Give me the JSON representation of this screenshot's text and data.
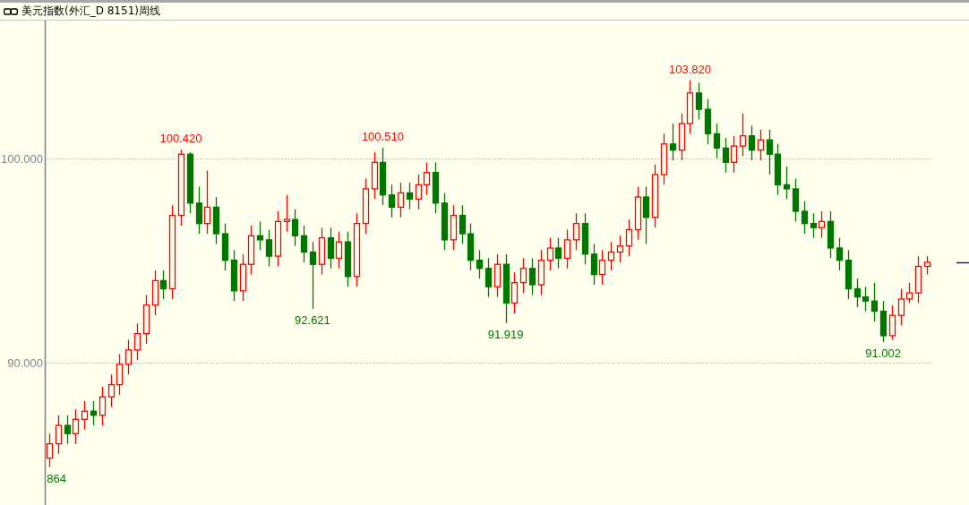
{
  "window": {
    "title": "美元指数(外汇_D 8151)周线"
  },
  "chart": {
    "chart_data": {
      "type": "candlestick",
      "ylim": [
        83,
        106.75
      ],
      "yticks": [
        {
          "value": 90,
          "label": "90.000"
        },
        {
          "value": 100,
          "label": "100.000"
        }
      ],
      "ohlc": [
        [
          85.3,
          86.5,
          84.86,
          86.0
        ],
        [
          86.0,
          87.4,
          85.5,
          86.9
        ],
        [
          86.9,
          87.4,
          86.0,
          86.5
        ],
        [
          86.5,
          87.7,
          86.0,
          87.2
        ],
        [
          87.2,
          88.1,
          86.7,
          87.6
        ],
        [
          87.6,
          88.1,
          86.9,
          87.4
        ],
        [
          87.4,
          88.8,
          86.9,
          88.3
        ],
        [
          88.3,
          89.4,
          87.8,
          88.9
        ],
        [
          88.9,
          90.4,
          88.4,
          89.9
        ],
        [
          89.9,
          91.1,
          89.4,
          90.6
        ],
        [
          90.6,
          91.9,
          90.1,
          91.4
        ],
        [
          91.4,
          93.3,
          90.9,
          92.8
        ],
        [
          92.8,
          94.5,
          92.3,
          94.0
        ],
        [
          94.0,
          94.5,
          93.1,
          93.6
        ],
        [
          93.6,
          97.7,
          93.1,
          97.2
        ],
        [
          97.2,
          100.42,
          96.7,
          100.2
        ],
        [
          100.2,
          100.3,
          97.3,
          97.8
        ],
        [
          97.8,
          98.6,
          96.3,
          96.8
        ],
        [
          96.8,
          99.4,
          96.3,
          97.6
        ],
        [
          97.6,
          98.1,
          95.8,
          96.3
        ],
        [
          96.3,
          96.8,
          94.5,
          95.0
        ],
        [
          95.0,
          95.5,
          93.0,
          93.5
        ],
        [
          93.5,
          95.3,
          93.0,
          94.8
        ],
        [
          94.8,
          96.7,
          94.3,
          96.2
        ],
        [
          96.2,
          96.9,
          95.5,
          96.0
        ],
        [
          96.0,
          96.5,
          94.7,
          95.2
        ],
        [
          95.2,
          97.4,
          94.7,
          96.9
        ],
        [
          96.9,
          98.2,
          96.4,
          97.0
        ],
        [
          97.0,
          97.5,
          95.7,
          96.2
        ],
        [
          96.2,
          96.7,
          94.9,
          95.4
        ],
        [
          95.4,
          95.9,
          92.62,
          94.8
        ],
        [
          94.8,
          96.6,
          94.3,
          96.1
        ],
        [
          96.1,
          96.6,
          94.6,
          95.1
        ],
        [
          95.1,
          96.4,
          94.6,
          95.9
        ],
        [
          95.9,
          96.4,
          93.7,
          94.2
        ],
        [
          94.2,
          97.3,
          93.7,
          96.8
        ],
        [
          96.8,
          99.0,
          96.3,
          98.5
        ],
        [
          98.5,
          100.3,
          98.0,
          99.8
        ],
        [
          99.8,
          100.51,
          97.7,
          98.2
        ],
        [
          98.2,
          98.7,
          97.1,
          97.6
        ],
        [
          97.6,
          98.8,
          97.1,
          98.3
        ],
        [
          98.3,
          98.8,
          97.5,
          98.0
        ],
        [
          98.0,
          99.2,
          97.5,
          98.7
        ],
        [
          98.7,
          99.8,
          98.2,
          99.3
        ],
        [
          99.3,
          99.8,
          97.3,
          97.8
        ],
        [
          97.8,
          98.3,
          95.5,
          96.0
        ],
        [
          96.0,
          97.7,
          95.5,
          97.2
        ],
        [
          97.2,
          97.7,
          95.8,
          96.3
        ],
        [
          96.3,
          96.8,
          94.5,
          95.0
        ],
        [
          95.0,
          95.5,
          94.1,
          94.6
        ],
        [
          94.6,
          95.1,
          93.2,
          93.7
        ],
        [
          93.7,
          95.3,
          93.2,
          94.8
        ],
        [
          94.8,
          95.3,
          91.92,
          92.9
        ],
        [
          92.9,
          94.4,
          92.4,
          93.9
        ],
        [
          93.9,
          95.1,
          93.4,
          94.6
        ],
        [
          94.6,
          95.1,
          93.3,
          93.8
        ],
        [
          93.8,
          95.5,
          93.3,
          95.0
        ],
        [
          95.0,
          96.1,
          94.5,
          95.6
        ],
        [
          95.6,
          96.1,
          94.6,
          95.1
        ],
        [
          95.1,
          96.5,
          94.6,
          96.0
        ],
        [
          96.0,
          97.3,
          95.5,
          96.8
        ],
        [
          96.8,
          97.3,
          94.8,
          95.3
        ],
        [
          95.3,
          95.8,
          93.8,
          94.3
        ],
        [
          94.3,
          95.5,
          93.8,
          95.0
        ],
        [
          95.0,
          95.9,
          94.5,
          95.4
        ],
        [
          95.4,
          96.2,
          94.9,
          95.7
        ],
        [
          95.7,
          97.0,
          95.2,
          96.5
        ],
        [
          96.5,
          98.6,
          96.0,
          98.1
        ],
        [
          98.1,
          98.6,
          95.8,
          97.1
        ],
        [
          97.1,
          99.7,
          96.6,
          99.2
        ],
        [
          99.2,
          101.2,
          98.7,
          100.7
        ],
        [
          100.7,
          101.7,
          99.9,
          100.4
        ],
        [
          100.4,
          102.2,
          99.9,
          101.7
        ],
        [
          101.7,
          103.82,
          101.2,
          103.2
        ],
        [
          103.2,
          103.7,
          101.9,
          102.4
        ],
        [
          102.4,
          102.9,
          100.7,
          101.2
        ],
        [
          101.2,
          101.7,
          100.0,
          100.5
        ],
        [
          100.5,
          101.0,
          99.3,
          99.8
        ],
        [
          99.8,
          101.1,
          99.3,
          100.6
        ],
        [
          100.6,
          102.2,
          100.1,
          101.1
        ],
        [
          101.1,
          101.6,
          99.9,
          100.4
        ],
        [
          100.4,
          101.4,
          99.9,
          100.9
        ],
        [
          100.9,
          101.4,
          99.2,
          100.2
        ],
        [
          100.2,
          100.7,
          98.2,
          98.7
        ],
        [
          98.7,
          99.6,
          98.0,
          98.5
        ],
        [
          98.5,
          99.0,
          96.9,
          97.4
        ],
        [
          97.4,
          97.9,
          96.3,
          96.8
        ],
        [
          96.8,
          97.3,
          96.1,
          96.6
        ],
        [
          96.6,
          97.4,
          96.1,
          96.9
        ],
        [
          96.9,
          97.4,
          95.1,
          95.6
        ],
        [
          95.6,
          96.1,
          94.5,
          95.0
        ],
        [
          95.0,
          95.5,
          93.1,
          93.6
        ],
        [
          93.6,
          94.1,
          92.7,
          93.2
        ],
        [
          93.2,
          93.7,
          92.5,
          93.0
        ],
        [
          93.0,
          93.9,
          92.0,
          92.5
        ],
        [
          92.5,
          93.0,
          91.0,
          91.3
        ],
        [
          91.3,
          92.8,
          91.1,
          92.3
        ],
        [
          92.3,
          93.6,
          91.8,
          93.1
        ],
        [
          93.1,
          93.9,
          92.9,
          93.4
        ],
        [
          93.4,
          95.2,
          92.9,
          94.7
        ],
        [
          94.7,
          95.2,
          94.3,
          94.9
        ]
      ],
      "annotations": [
        "864",
        "100.420",
        "92.621",
        "100.510",
        "91.919",
        "103.820",
        "91.002"
      ]
    }
  }
}
